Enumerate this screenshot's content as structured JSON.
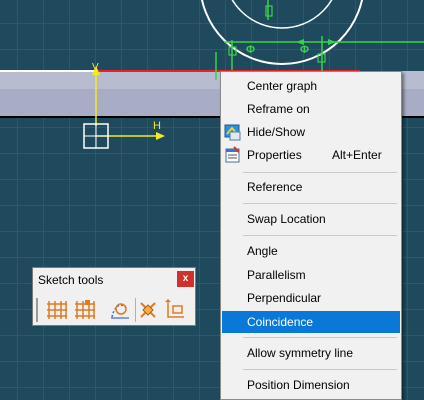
{
  "canvas": {
    "background": "#1f4a5e",
    "axis_h_label": "H",
    "axis_v_label": "V",
    "constraint_symbol": "Φ"
  },
  "context_menu": {
    "items": [
      {
        "label": "Center graph",
        "icon": null,
        "shortcut": ""
      },
      {
        "label": "Reframe on",
        "icon": null,
        "shortcut": ""
      },
      {
        "label": "Hide/Show",
        "icon": "hide-show-icon",
        "shortcut": ""
      },
      {
        "label": "Properties",
        "icon": "properties-icon",
        "shortcut": "Alt+Enter"
      },
      {
        "label": "Reference",
        "icon": null,
        "shortcut": ""
      },
      {
        "label": "Swap Location",
        "icon": null,
        "shortcut": ""
      },
      {
        "label": "Angle",
        "icon": null,
        "shortcut": ""
      },
      {
        "label": "Parallelism",
        "icon": null,
        "shortcut": ""
      },
      {
        "label": "Perpendicular",
        "icon": null,
        "shortcut": ""
      },
      {
        "label": "Coincidence",
        "icon": null,
        "shortcut": "",
        "highlighted": true
      },
      {
        "label": "Allow symmetry line",
        "icon": null,
        "shortcut": ""
      },
      {
        "label": "Position Dimension",
        "icon": null,
        "shortcut": ""
      }
    ],
    "highlight_color": "#0a78d7"
  },
  "sketch_tools": {
    "title": "Sketch tools",
    "close_label": "x",
    "buttons": [
      {
        "name": "snap-to-point-icon"
      },
      {
        "name": "construction-grid-icon"
      },
      {
        "name": "geometrical-constraints-icon"
      },
      {
        "name": "dimensional-constraints-icon"
      },
      {
        "name": "auto-constraint-icon"
      }
    ],
    "icon_color": "#e07a1f"
  }
}
